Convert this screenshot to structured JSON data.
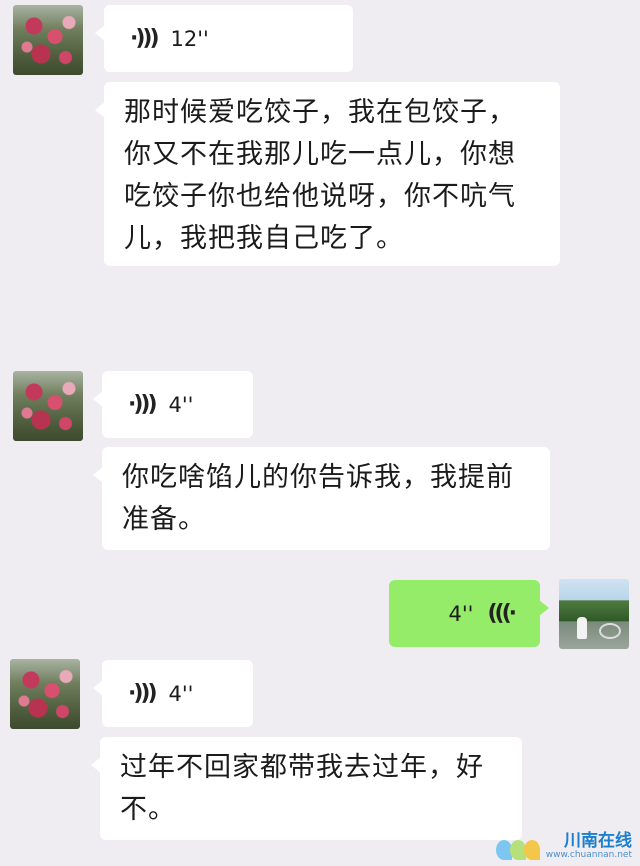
{
  "messages": [
    {
      "type": "voice",
      "side": "left",
      "duration": "12''"
    },
    {
      "type": "text",
      "side": "left",
      "lines": [
        "那时候爱吃饺子，我在包饺子，",
        "你又不在我那儿吃一点儿，你想",
        "吃饺子你也给他说呀，你不吭气",
        "儿，我把我自己吃了。"
      ]
    },
    {
      "type": "voice",
      "side": "left",
      "duration": "4''"
    },
    {
      "type": "text",
      "side": "left",
      "lines": [
        "你吃啥馅儿的你告诉我，我提前",
        "准备。"
      ]
    },
    {
      "type": "voice",
      "side": "right",
      "duration": "4''"
    },
    {
      "type": "voice",
      "side": "left",
      "duration": "4''"
    },
    {
      "type": "text",
      "side": "left",
      "lines": [
        "过年不回家都带我去过年，好",
        "不。"
      ]
    }
  ],
  "icons": {
    "voice_left": "voice-wave-icon",
    "voice_right": "voice-wave-icon"
  },
  "watermark": {
    "title": "川南在线",
    "url": "www.chuannan.net"
  },
  "colors": {
    "background": "#efedf2",
    "incoming_bubble": "#ffffff",
    "outgoing_bubble": "#95ec69"
  }
}
